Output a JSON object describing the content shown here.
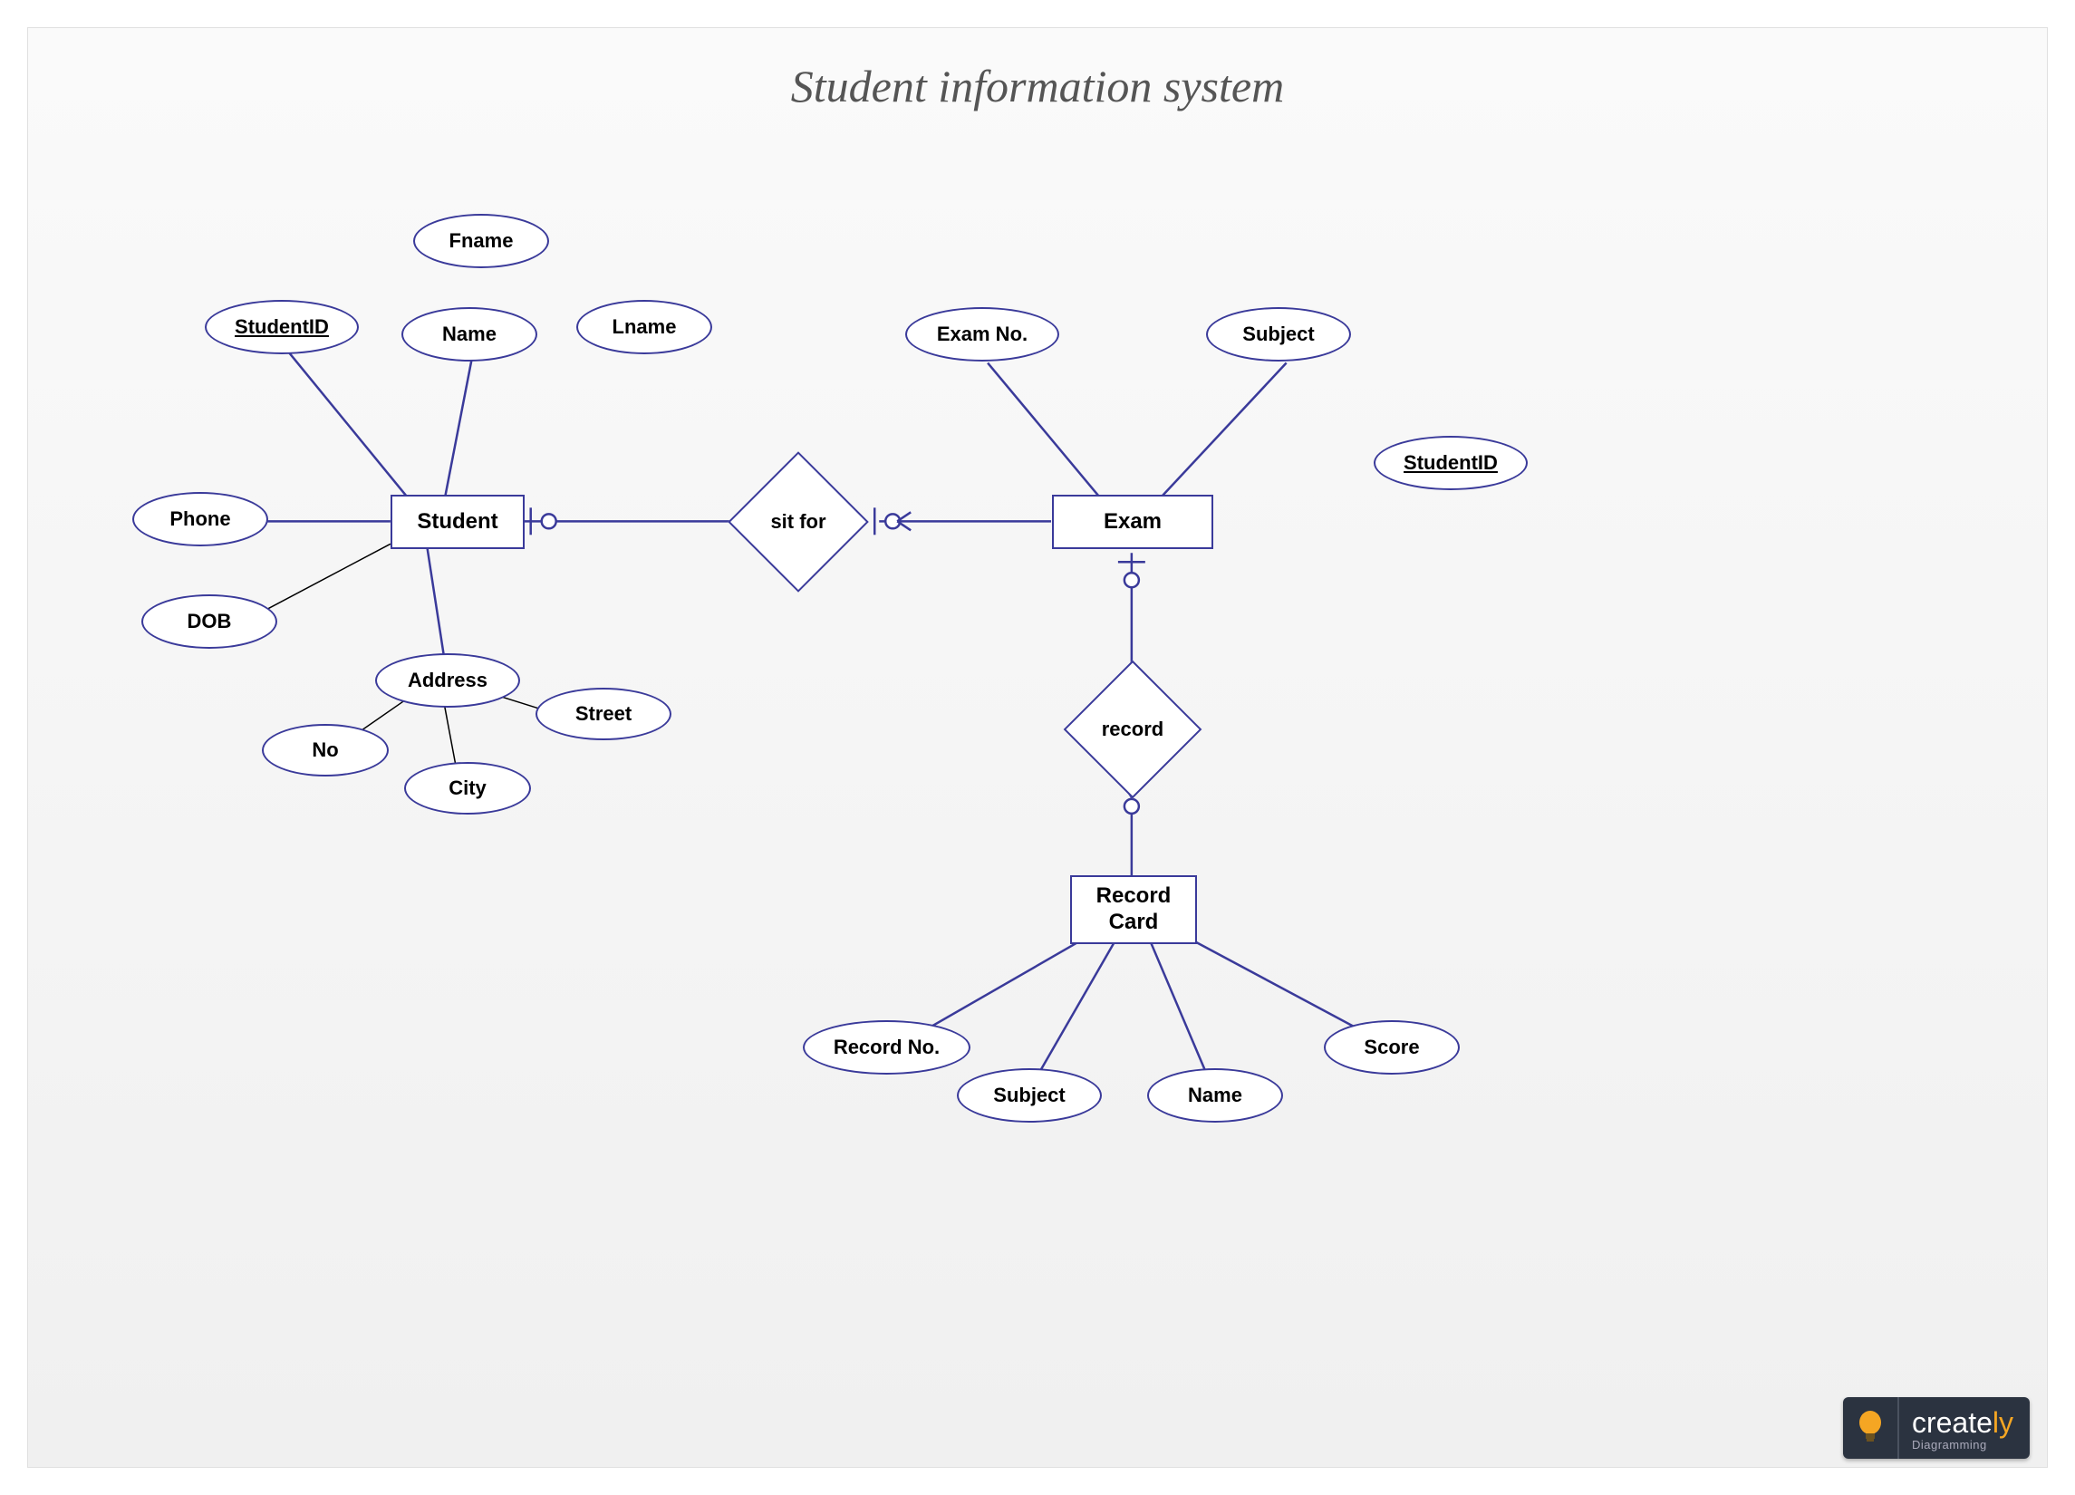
{
  "title": "Student information system",
  "entities": {
    "student": "Student",
    "exam": "Exam",
    "recordCard": "Record\nCard"
  },
  "relationships": {
    "sitFor": "sit for",
    "record": "record"
  },
  "attributes": {
    "studentId": "StudentID",
    "fname": "Fname",
    "name": "Name",
    "lname": "Lname",
    "phone": "Phone",
    "dob": "DOB",
    "address": "Address",
    "no": "No",
    "city": "City",
    "street": "Street",
    "examNo": "Exam No.",
    "subject": "Subject",
    "studentId2": "StudentID",
    "recordNo": "Record No.",
    "rcSubject": "Subject",
    "rcName": "Name",
    "score": "Score"
  },
  "logo": {
    "brand1": "create",
    "brand2": "ly",
    "sub": "Diagramming"
  }
}
